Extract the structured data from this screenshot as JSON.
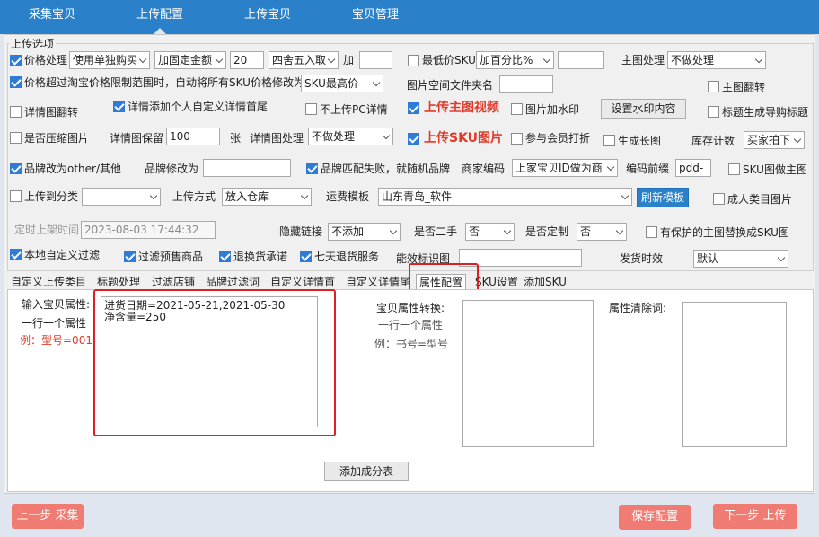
{
  "nav": [
    "采集宝贝",
    "上传配置",
    "上传宝贝",
    "宝贝管理"
  ],
  "group_title": "上传选项",
  "row1": {
    "price_label": "价格处理",
    "price_mode": "使用单独购买",
    "price_add": "加固定金额",
    "price_value": "20",
    "round": "四舍五入取",
    "add_label": "加",
    "min_sku_label": "最低价SKU",
    "min_sku_mode": "加百分比%",
    "main_img_label": "主图处理",
    "main_img_mode": "不做处理"
  },
  "row2": {
    "over_limit_label": "价格超过淘宝价格限制范围时，自动将所有SKU价格修改为",
    "over_limit_mode": "SKU最高价",
    "img_folder_label": "图片空间文件夹名",
    "main_flip_label": "主图翻转"
  },
  "row3": {
    "detail_flip_label": "详情图翻转",
    "detail_custom_label": "详情添加个人自定义详情首尾",
    "no_pc_label": "不上传PC详情",
    "upload_video_label": "上传主图视频",
    "watermark_label": "图片加水印",
    "watermark_btn": "设置水印内容",
    "title_guide_label": "标题生成导购标题"
  },
  "row4": {
    "compress_label": "是否压缩图片",
    "keep_label": "详情图保留",
    "keep_value": "100",
    "unit": "张",
    "detail_proc_label": "详情图处理",
    "detail_proc_mode": "不做处理",
    "upload_sku_label": "上传SKU图片",
    "member_label": "参与会员打折",
    "long_img_label": "生成长图",
    "stock_label": "库存计数",
    "stock_mode": "买家拍下"
  },
  "row5": {
    "brand_other_label": "品牌改为other/其他",
    "brand_change_label": "品牌修改为",
    "brand_match_label": "品牌匹配失败，就随机品牌",
    "merchant_code_label": "商家编码",
    "merchant_code_mode": "上家宝贝ID做为商",
    "code_prefix_label": "编码前缀",
    "code_prefix_value": "pdd-",
    "sku_main_label": "SKU图做主图"
  },
  "row6": {
    "upload_cat_label": "上传到分类",
    "upload_method_label": "上传方式",
    "upload_method_mode": "放入仓库",
    "freight_label": "运费模板",
    "freight_mode": "山东青岛_软件",
    "refresh_btn": "刷新模板",
    "adult_label": "成人类目图片"
  },
  "row7": {
    "timed_label": "定时上架时间",
    "timed_value": "2023-08-03 17:44:32",
    "hide_link_label": "隐藏链接",
    "hide_link_mode": "不添加",
    "second_hand_label": "是否二手",
    "second_hand_mode": "否",
    "custom_label": "是否定制",
    "custom_mode": "否",
    "protect_label": "有保护的主图替换成SKU图"
  },
  "row8": {
    "local_filter_label": "本地自定义过滤",
    "presale_label": "过滤预售商品",
    "return_label": "退换货承诺",
    "seven_day_label": "七天退货服务",
    "efficacy_label": "能效标识图",
    "ship_label": "发货时效",
    "ship_mode": "默认"
  },
  "tabs": [
    "自定义上传类目",
    "标题处理",
    "过滤店铺",
    "品牌过滤词",
    "自定义详情首",
    "自定义详情尾",
    "属性配置",
    "SKU设置",
    "添加SKU"
  ],
  "attr": {
    "input_label": "输入宝贝属性:",
    "one_per_line": "一行一个属性",
    "example": "例：型号=001",
    "input_value": "进货日期=2021-05-21,2021-05-30\n净含量=250",
    "convert_label": "宝贝属性转换:",
    "convert_hint1": "一行一个属性",
    "convert_hint2": "例：书号=型号",
    "clear_label": "属性清除词:",
    "add_table_btn": "添加成分表"
  },
  "footer": {
    "prev": "上一步 采集",
    "save": "保存配置",
    "next": "下一步 上传"
  }
}
